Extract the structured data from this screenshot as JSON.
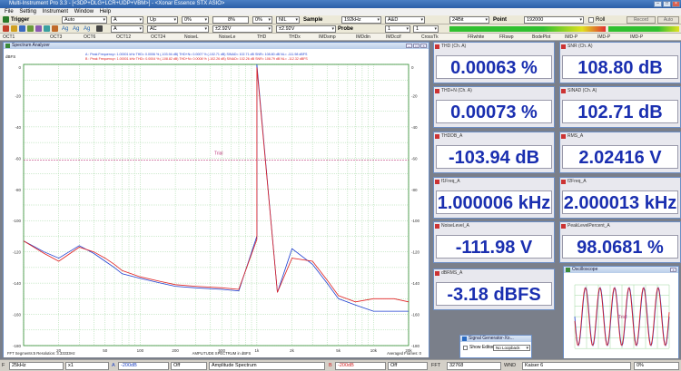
{
  "app": {
    "title": "Multi-Instrument Pro 3.3 - [<3DP+DLG+LCR+UDP+VBM>] - <Xonar Essence STX ASIO>",
    "menu": [
      "File",
      "Setting",
      "Instrument",
      "Window",
      "Help"
    ]
  },
  "toolbar1": {
    "trigger_label": "Trigger",
    "trigger_mode": "Auto",
    "channel": "A",
    "edge": "Up",
    "level": "0%",
    "pretrigger": "8%",
    "pretrigger_pct": "0%",
    "filter": "NIL",
    "sample_label": "Sample",
    "sample_rate": "192kHz",
    "weighting": "A&D",
    "bits": "24Bit",
    "point_label": "Point",
    "points": "192000",
    "roll_label": "Roll",
    "record_label": "Record",
    "auto_label": "Auto"
  },
  "toolbar2": {
    "zoom_labels": [
      "Ag",
      "Ag",
      "Ag"
    ],
    "time_channel": "A",
    "coupling": "AC",
    "range1": "±2.92V",
    "range2": "±2.92V",
    "probe_label": "Probe",
    "probe_a": "1",
    "probe_b": "1"
  },
  "tabs": [
    "OCT1",
    "OCT3",
    "OCT6",
    "OCT12",
    "OCT24",
    "NoiseL",
    "NoiseLe",
    "THD",
    "THDx",
    "IMDsmp",
    "IMDdin",
    "IMDccif",
    "CrossTk",
    "FRwhite",
    "FRswp",
    "BodePlot",
    "IMD-P",
    "IMD-P",
    "IMD-P"
  ],
  "spectrum": {
    "title": "Spectrum Analyzer",
    "unit": "dBFS",
    "legend": [
      "A : Peak Frequency=   1.00001   kHz  THD=   0.0006 %  (-103.94 dB)  THD+N=   0.0007 %  (-102.71 dB)  SINAD=  102.71 dB  SNR=  108.80 dB  NL=  -111.98 dBFS",
      "B : Peak Frequency=   1.00001   kHz  THD=   0.0004 %  (-108.82 dB)  THD+N=   0.0008 %  (-102.26 dB)  SINAD=  102.26 dB  SNR=  108.79 dB  NL=  -112.32 dBFS"
    ],
    "trial_label": "Trial",
    "footer_left": "FFT Segments:5     Resolution: 3.33333Hz",
    "footer_mid": "AMPLITUDE SPECTRUM in dBFS",
    "footer_right": "Averaged Frames: 0",
    "y_ticks_left": [
      "0",
      "-20",
      "-40",
      "-60",
      "-80",
      "-100",
      "-120",
      "-140",
      "-160",
      "-180"
    ],
    "y_ticks_right": [
      "0",
      "-20",
      "-40",
      "-60",
      "-80",
      "-100",
      "-120",
      "-140",
      "-160",
      "-180"
    ],
    "x_ticks": [
      "20",
      "50",
      "100",
      "200",
      "500",
      "1k",
      "2k",
      "5k",
      "10k",
      "20k"
    ],
    "colors": {
      "a": "#1f3fd0",
      "b": "#e02020",
      "grid": "#4caf50",
      "bg": "#ffffff"
    }
  },
  "chart_data": {
    "type": "line",
    "xlabel": "AMPLITUDE SPECTRUM in dBFS",
    "x_scale": "log",
    "xlim": [
      10,
      20000
    ],
    "ylim": [
      -180,
      0
    ],
    "grid": true,
    "series": [
      {
        "name": "A",
        "x": [
          10,
          15,
          20,
          30,
          40,
          50,
          60,
          70,
          100,
          150,
          200,
          300,
          500,
          700,
          1000,
          1000.01,
          1500,
          2000,
          3000,
          4000,
          5000,
          7000,
          10000,
          15000,
          20000
        ],
        "y": [
          -113,
          -120,
          -124,
          -116,
          -121,
          -126,
          -130,
          -134,
          -137,
          -140,
          -142,
          -143,
          -144,
          -145,
          -110,
          0,
          -146,
          -118,
          -128,
          -140,
          -150,
          -154,
          -158,
          -158,
          -158
        ]
      },
      {
        "name": "B",
        "x": [
          10,
          15,
          20,
          30,
          40,
          50,
          60,
          70,
          100,
          150,
          200,
          300,
          500,
          700,
          1000,
          1000.01,
          1500,
          2000,
          3000,
          4000,
          5000,
          7000,
          10000,
          15000,
          20000
        ],
        "y": [
          -113,
          -121,
          -126,
          -117,
          -120,
          -124,
          -128,
          -132,
          -136,
          -139,
          -141,
          -142,
          -143,
          -144,
          -112,
          -2,
          -146,
          -124,
          -126,
          -138,
          -148,
          -152,
          -150,
          -150,
          -152
        ]
      }
    ]
  },
  "meters": [
    {
      "name": "THD (Ch. A)",
      "value": "0.00063 %"
    },
    {
      "name": "SNR (Ch. A)",
      "value": "108.80 dB"
    },
    {
      "name": "THD+N (Ch. A)",
      "value": "0.00073 %"
    },
    {
      "name": "SINAD (Ch. A)",
      "value": "102.71 dB"
    },
    {
      "name": "THDDB_A",
      "value": "-103.94 dB"
    },
    {
      "name": "RMS_A",
      "value": "2.02416 V"
    },
    {
      "name": "f1Freq_A",
      "value": "1.000006 kHz"
    },
    {
      "name": "f2Freq_A",
      "value": "2.000013 kHz"
    },
    {
      "name": "NoiseLevel_A",
      "value": "-111.98 V"
    },
    {
      "name": "PeakLevelPercent_A",
      "value": "98.0681 %"
    },
    {
      "name": "dBRMS_A",
      "value": "-3.18 dBFS"
    }
  ],
  "oscilloscope": {
    "title": "Oscilloscope",
    "trial_label": "Trial"
  },
  "siggen": {
    "title": "Signal Generator-Xo...",
    "show_editor": "Show Editor",
    "loopback": "No Loopback"
  },
  "statusbar": {
    "f_label": "F",
    "freq_range": "25kHz",
    "zoom": "x1",
    "a_label": "A",
    "a_level": "-200dB",
    "a_off": "Off",
    "mode": "Amplitude Spectrum",
    "b_label": "B",
    "b_level": "-200dB",
    "b_off": "Off",
    "fft_label": "FFT",
    "fft_size": "32768",
    "wnd_label": "WND",
    "window": "Kaiser 6",
    "overlap": "0%"
  }
}
